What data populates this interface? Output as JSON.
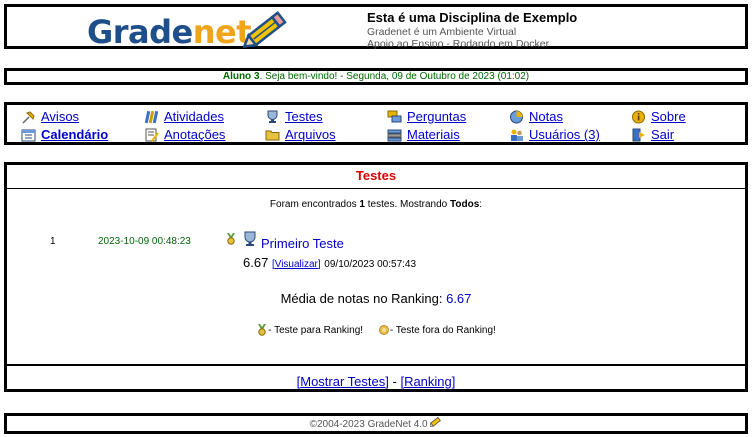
{
  "header": {
    "logo_part1": "Grade",
    "logo_part2": "net",
    "course_title": "Esta é uma Disciplina de Exemplo",
    "subtitle1": "Gradenet é um Ambiente Virtual",
    "subtitle2": "Apoio ao Ensino - Rodando em Docker"
  },
  "welcome": {
    "user": "Aluno 3",
    "message": ". Seja bem-vindo! - Segunda, 09 de Outubro de 2023 (01:02)"
  },
  "menu": {
    "items": [
      {
        "label": "Avisos",
        "icon": "pin-icon"
      },
      {
        "label": "Atividades",
        "icon": "books-icon"
      },
      {
        "label": "Testes",
        "icon": "trophy-icon"
      },
      {
        "label": "Perguntas",
        "icon": "chat-icon"
      },
      {
        "label": "Notas",
        "icon": "pie-chart-icon"
      },
      {
        "label": "Sobre",
        "icon": "info-icon"
      },
      {
        "label": "Calendário",
        "icon": "calendar-icon"
      },
      {
        "label": "Anotações",
        "icon": "notes-icon"
      },
      {
        "label": "Arquivos",
        "icon": "folder-icon"
      },
      {
        "label": "Materiais",
        "icon": "stack-icon"
      },
      {
        "label": "Usuários (3)",
        "icon": "users-icon"
      },
      {
        "label": "Sair",
        "icon": "exit-icon"
      }
    ]
  },
  "content": {
    "title": "Testes",
    "found_pre": "Foram encontrados ",
    "found_count": "1",
    "found_mid": " testes. Mostrando ",
    "found_filter": "Todos",
    "found_end": ":",
    "test": {
      "number": "1",
      "date": "2023-10-09 00:48:23",
      "name": "Primeiro Teste",
      "score": "6.67",
      "view_label": "Visualizar",
      "submitted": "09/10/2023 00:57:43"
    },
    "avg_label": "Média de notas no Ranking: ",
    "avg_value": "6.67",
    "legend_ranking": " - Teste para Ranking!",
    "legend_off": " - Teste fora do Ranking!",
    "link_show": "Mostrar Testes",
    "link_ranking": "Ranking",
    "link_sep": " - "
  },
  "footer": {
    "text": "©2004-2023 GradeNet 4.0"
  },
  "colors": {
    "link": "#0000cc",
    "title_red": "#e00000",
    "green": "#006600"
  }
}
